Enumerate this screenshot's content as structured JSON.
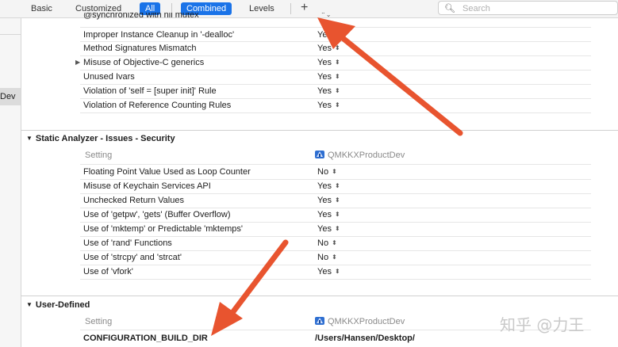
{
  "toolbar": {
    "tabs": [
      {
        "label": "Basic"
      },
      {
        "label": "Customized"
      },
      {
        "label": "All"
      },
      {
        "label": "Combined"
      },
      {
        "label": "Levels"
      }
    ],
    "add_label": "+",
    "search_placeholder": "Search"
  },
  "sidebar": {
    "selected_label": "Dev"
  },
  "sections": {
    "top_rows": [
      {
        "label": "@synchronized with nil mutex",
        "value": ""
      },
      {
        "label": "Improper Instance Cleanup in '-dealloc'",
        "value": "Yes"
      },
      {
        "label": "Method Signatures Mismatch",
        "value": "Yes"
      },
      {
        "label": "Misuse of Objective-C generics",
        "value": "Yes"
      },
      {
        "label": "Unused Ivars",
        "value": "Yes"
      },
      {
        "label": "Violation of 'self = [super init]' Rule",
        "value": "Yes"
      },
      {
        "label": "Violation of Reference Counting Rules",
        "value": "Yes"
      }
    ],
    "security": {
      "title": "Static Analyzer - Issues - Security",
      "setting_header": "Setting",
      "target_name": "QMKKXProductDev",
      "rows": [
        {
          "label": "Floating Point Value Used as Loop Counter",
          "value": "No"
        },
        {
          "label": "Misuse of Keychain Services API",
          "value": "Yes"
        },
        {
          "label": "Unchecked Return Values",
          "value": "Yes"
        },
        {
          "label": "Use of 'getpw', 'gets' (Buffer Overflow)",
          "value": "Yes"
        },
        {
          "label": "Use of 'mktemp' or Predictable 'mktemps'",
          "value": "Yes"
        },
        {
          "label": "Use of 'rand' Functions",
          "value": "No"
        },
        {
          "label": "Use of 'strcpy' and 'strcat'",
          "value": "No"
        },
        {
          "label": "Use of 'vfork'",
          "value": "Yes"
        }
      ]
    },
    "user_defined": {
      "title": "User-Defined",
      "setting_header": "Setting",
      "target_name": "QMKKXProductDev",
      "rows": [
        {
          "label": "CONFIGURATION_BUILD_DIR",
          "value": "/Users/Hansen/Desktop/"
        }
      ]
    }
  },
  "watermark": "知乎 @力王",
  "colors": {
    "accent": "#1a73e8",
    "annotation_arrow": "#e8542f"
  }
}
